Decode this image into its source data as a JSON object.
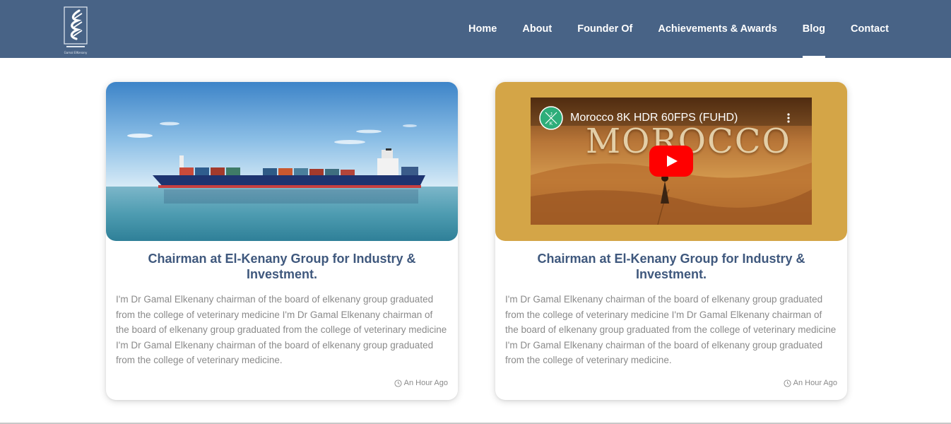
{
  "brand": {
    "logo_caption": "Gamal ElKenany"
  },
  "nav": {
    "items": [
      {
        "label": "Home"
      },
      {
        "label": "About"
      },
      {
        "label": "Founder Of"
      },
      {
        "label": "Achievements & Awards"
      },
      {
        "label": "Blog"
      },
      {
        "label": "Contact"
      }
    ],
    "active": "Blog"
  },
  "cards": [
    {
      "media": "container-ship-image",
      "title": "Chairman at El-Kenany Group for Industry & Investment.",
      "text": "I'm Dr Gamal Elkenany chairman of the board of elkenany group graduated from the college of veterinary medicine I'm Dr Gamal Elkenany chairman of the board of elkenany group graduated from the college of veterinary medicine I'm Dr Gamal Elkenany chairman of the board of elkenany group graduated from the college of veterinary medicine.",
      "time": "An Hour Ago"
    },
    {
      "media": "youtube-embed",
      "video": {
        "title": "Morocco 8K HDR 60FPS (FUHD)",
        "overlay_text": "MOROCCO",
        "channel_initials": "J K"
      },
      "title": "Chairman at El-Kenany Group for Industry & Investment.",
      "text": "I'm Dr Gamal Elkenany chairman of the board of elkenany group graduated from the college of veterinary medicine I'm Dr Gamal Elkenany chairman of the board of elkenany group graduated from the college of veterinary medicine I'm Dr Gamal Elkenany chairman of the board of elkenany group graduated from the college of veterinary medicine.",
      "time": "An Hour Ago"
    }
  ],
  "colors": {
    "navbar": "#486386",
    "title": "#3f587d",
    "video_frame": "#d4a547",
    "body_text": "#8a8a8a"
  }
}
